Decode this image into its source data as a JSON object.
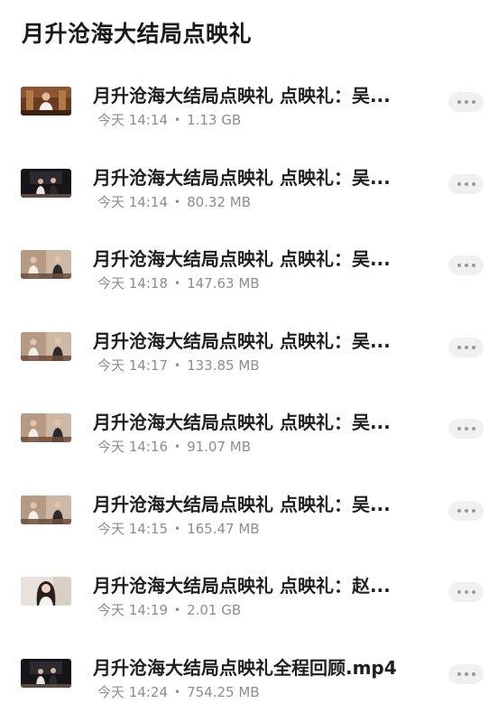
{
  "header": {
    "title": "月升沧海大结局点映礼"
  },
  "files": [
    {
      "name": "月升沧海大结局点映礼 点映礼：吴...",
      "time": "今天 14:14",
      "size": "1.13 GB",
      "thumb": "single-host-icon"
    },
    {
      "name": "月升沧海大结局点映礼 点映礼：吴...",
      "time": "今天 14:14",
      "size": "80.32 MB",
      "thumb": "stage-dark-icon"
    },
    {
      "name": "月升沧海大结局点映礼 点映礼：吴...",
      "time": "今天 14:18",
      "size": "147.63 MB",
      "thumb": "duo-split-icon"
    },
    {
      "name": "月升沧海大结局点映礼 点映礼：吴...",
      "time": "今天 14:17",
      "size": "133.85 MB",
      "thumb": "duo-split-icon"
    },
    {
      "name": "月升沧海大结局点映礼 点映礼：吴...",
      "time": "今天 14:16",
      "size": "91.07 MB",
      "thumb": "duo-split-icon"
    },
    {
      "name": "月升沧海大结局点映礼 点映礼：吴...",
      "time": "今天 14:15",
      "size": "165.47 MB",
      "thumb": "duo-split-icon"
    },
    {
      "name": "月升沧海大结局点映礼 点映礼：赵...",
      "time": "今天 14:19",
      "size": "2.01 GB",
      "thumb": "portrait-woman-icon"
    },
    {
      "name": "月升沧海大结局点映礼全程回顾.mp4",
      "time": "今天 14:24",
      "size": "754.25 MB",
      "thumb": "stage-dark-icon"
    }
  ],
  "separator": "•",
  "colors": {
    "text": "#1f1f1f",
    "meta": "#8d8d8d",
    "button_bg": "#f0f0f0",
    "dots": "#9a9a9a"
  }
}
